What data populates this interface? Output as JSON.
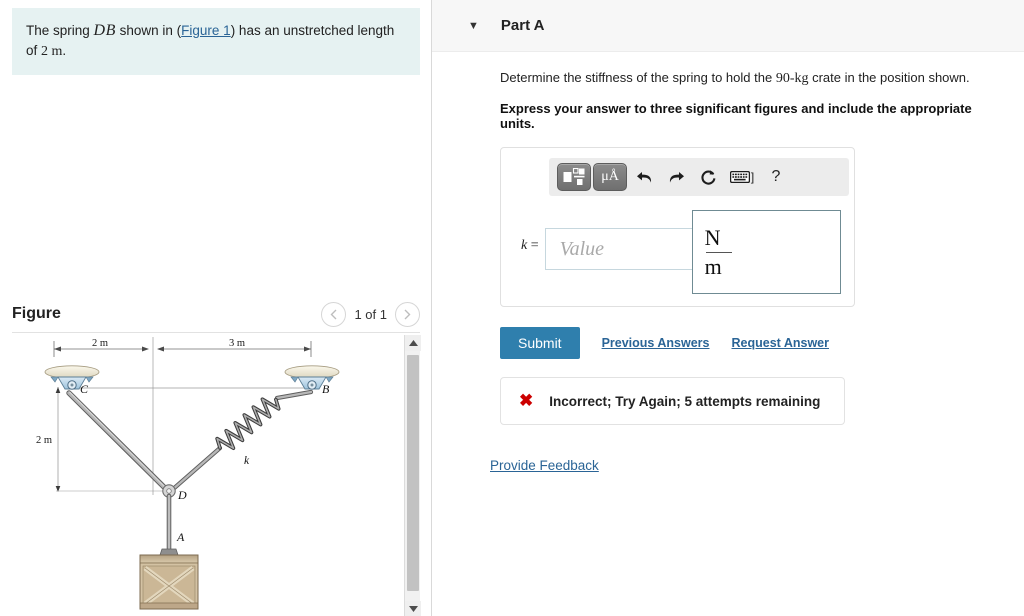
{
  "left": {
    "prompt": {
      "before": "The spring ",
      "math": "DB",
      "middle": " shown in (",
      "link": "Figure 1",
      "after": ") has an unstretched length of ",
      "length": "2 m",
      "period": "."
    },
    "figure": {
      "title": "Figure",
      "pager_label": "1 of 1",
      "prev_icon": "chevron-left-icon",
      "next_icon": "chevron-right-icon",
      "scroll_up_icon": "triangle-up-icon",
      "scroll_down_icon": "triangle-down-icon"
    },
    "diagram": {
      "labels": {
        "span_left": "2 m",
        "span_right": "3 m",
        "drop": "2 m",
        "point_c": "C",
        "point_b": "B",
        "point_d": "D",
        "point_a": "A",
        "spring_k": "k"
      },
      "colors": {
        "member": "#9a9a9a",
        "support_fill": "#bcd9ea",
        "support_plate": "#efeadb",
        "crate_fill": "#cbb796",
        "crate_edge": "#8d7a5c",
        "dim_line": "#8a8a8a"
      }
    }
  },
  "right": {
    "part": {
      "caret_icon": "caret-down-icon",
      "title": "Part A"
    },
    "question": {
      "line1_before": "Determine the stiffness of the spring to hold the ",
      "line1_mass": "90-kg",
      "line1_after": " crate in the position shown.",
      "line2": "Express your answer to three significant figures and include the appropriate units."
    },
    "toolbar": {
      "template_icon": "math-template-icon",
      "units_icon": "units-mu-angstrom-icon",
      "undo_icon": "undo-arrow-icon",
      "redo_icon": "redo-arrow-icon",
      "reset_icon": "reset-circular-arrow-icon",
      "keyboard_icon": "keyboard-icon",
      "keyboard_bracket": "]",
      "help_icon": "question-mark-icon",
      "help_label": "?",
      "units_label": "μÅ"
    },
    "answer": {
      "variable": "k",
      "equals": "=",
      "value_placeholder": "Value",
      "value": "",
      "unit_numerator": "N",
      "unit_denominator": "m"
    },
    "actions": {
      "submit_label": "Submit",
      "previous_answers_label": "Previous Answers",
      "request_answer_label": "Request Answer"
    },
    "feedback": {
      "icon": "red-x-icon",
      "message": "Incorrect; Try Again; 5 attempts remaining",
      "accent_color": "#cc0000"
    },
    "provide_feedback_label": "Provide Feedback",
    "colors": {
      "submit_bg": "#2f7fad",
      "link": "#2a6496",
      "header_bg": "#f7f7f7",
      "info_bg": "#e6f2f2"
    }
  }
}
